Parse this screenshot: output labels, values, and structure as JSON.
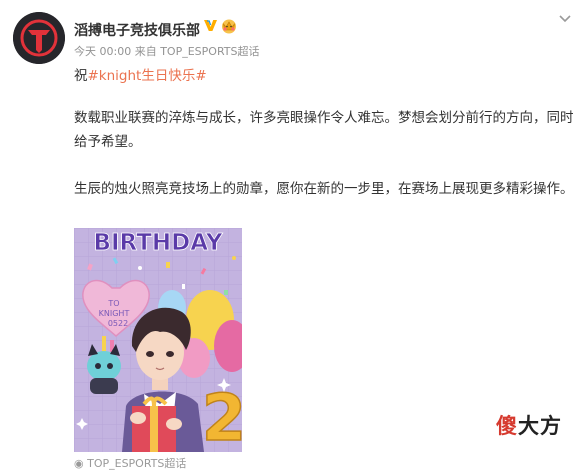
{
  "post": {
    "author": "滔搏电子竞技俱乐部",
    "meta_time": "今天 00:00",
    "meta_from": "来自",
    "meta_source": "TOP_ESPORTS超话",
    "line1_prefix": "祝",
    "hashtag": "#knight生日快乐#",
    "paragraph1": "数载职业联赛的淬炼与成长，许多亮眼操作令人难忘。梦想会划分前行的方向，同时给予希望。",
    "paragraph2": "生辰的烛火照亮竞技场上的勋章，愿你在新的一步里，在赛场上展现更多精彩操作。",
    "image": {
      "banner_text": "BIRTHDAY",
      "heart_line1": "TO",
      "heart_line2": "KNIGHT",
      "heart_line3": "0522",
      "big_number": "2"
    },
    "bottom_link": "TOP_ESPORTS超话"
  },
  "icons": {
    "verified": "verified-v-icon",
    "crown": "crown-badge-icon",
    "more": "chevron-down-icon",
    "link": "super-topic-icon"
  },
  "watermark": {
    "part1": "傻",
    "part2": "大方"
  },
  "colors": {
    "hashtag": "#eb7350",
    "meta": "#939393",
    "verified": "#ffae00",
    "poster_bg": "#c3b3e0",
    "banner": "#5a3aa8"
  }
}
